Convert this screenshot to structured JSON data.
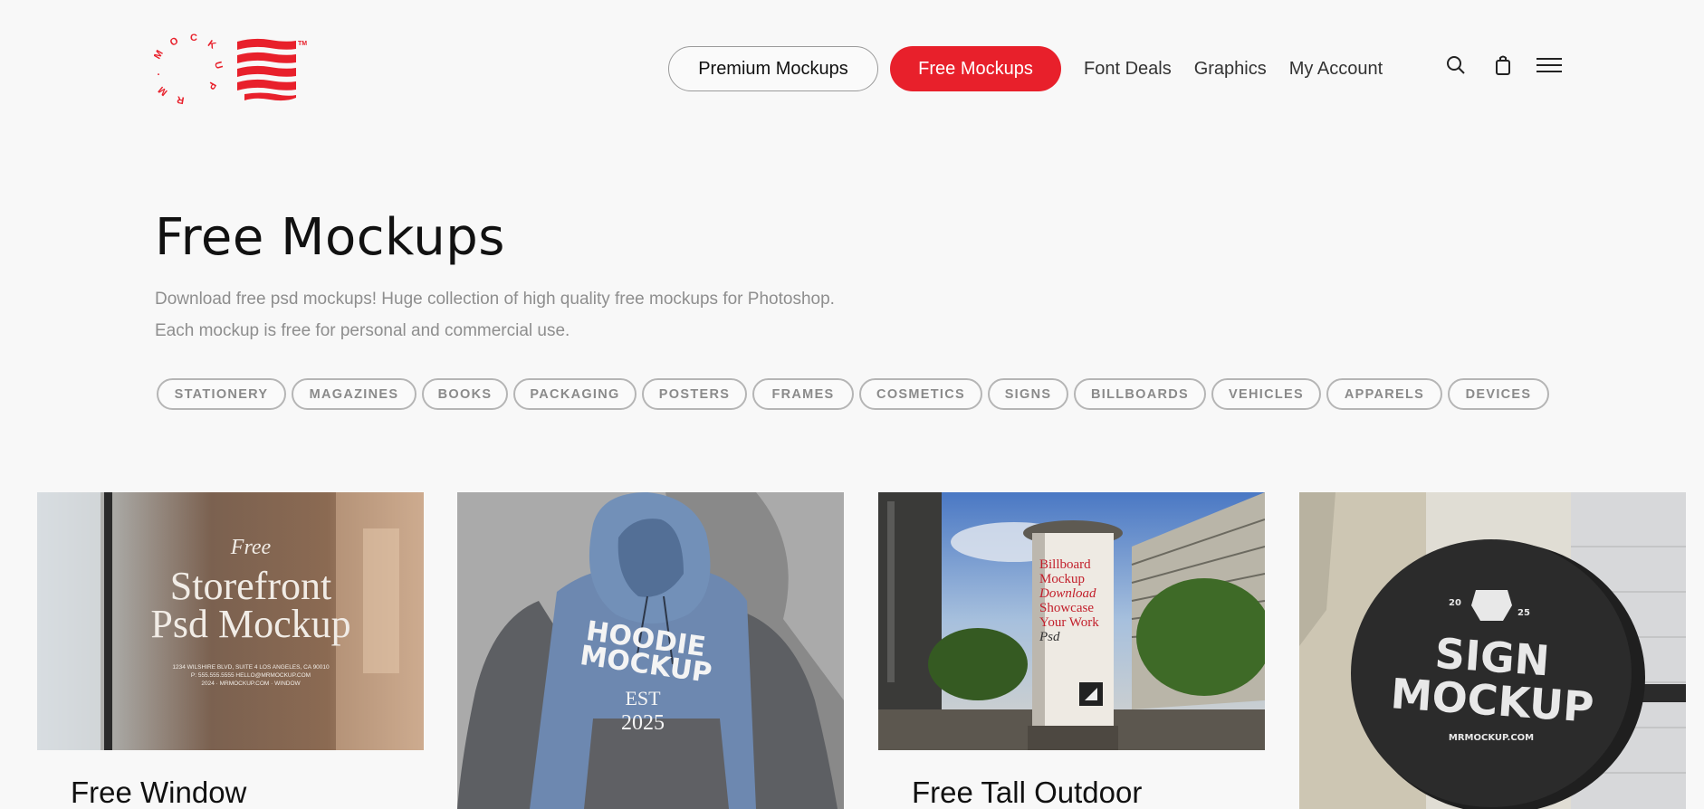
{
  "logo": {
    "letters": "MOCKUP.MR",
    "tm": "TM"
  },
  "nav": {
    "premium": "Premium Mockups",
    "free": "Free Mockups",
    "links": [
      "Font Deals",
      "Graphics",
      "My Account"
    ]
  },
  "icons": [
    "search-icon",
    "shopping-bag-icon",
    "menu-icon"
  ],
  "hero": {
    "title": "Free Mockups",
    "line1": "Download free psd mockups! Huge collection of high quality free mockups for Photoshop.",
    "line2": "Each mockup is free for personal and commercial use."
  },
  "categories": [
    "STATIONERY",
    "MAGAZINES",
    "BOOKS",
    "PACKAGING",
    "POSTERS",
    "FRAMES",
    "COSMETICS",
    "SIGNS",
    "BILLBOARDS",
    "VEHICLES",
    "APPARELS",
    "DEVICES"
  ],
  "cards": [
    {
      "title": "Free Window",
      "img_text": [
        "Free",
        "Storefront",
        "Psd Mockup",
        "1234 WILSHIRE BLVD, SUITE 4 LOS ANGELES, CA 90010",
        "P: 555.555.5555   HELLO@MRMOCKUP.COM",
        "2024 · MRMOCKUP.COM · WINDOW"
      ]
    },
    {
      "title": "",
      "img_text": [
        "HOODIE",
        "MOCKUP",
        "EST",
        "2025"
      ]
    },
    {
      "title": "Free Tall Outdoor",
      "img_text": [
        "Billboard",
        "Mockup",
        "Download",
        "Showcase",
        "Your Work",
        "Psd"
      ]
    },
    {
      "title": "",
      "img_text": [
        "20",
        "25",
        "SIGN",
        "MOCKUP",
        "MRMOCKUP.COM"
      ]
    }
  ],
  "colors": {
    "accent": "#e8202b",
    "background": "#f8f8f8",
    "muted": "#8e8e8e"
  }
}
